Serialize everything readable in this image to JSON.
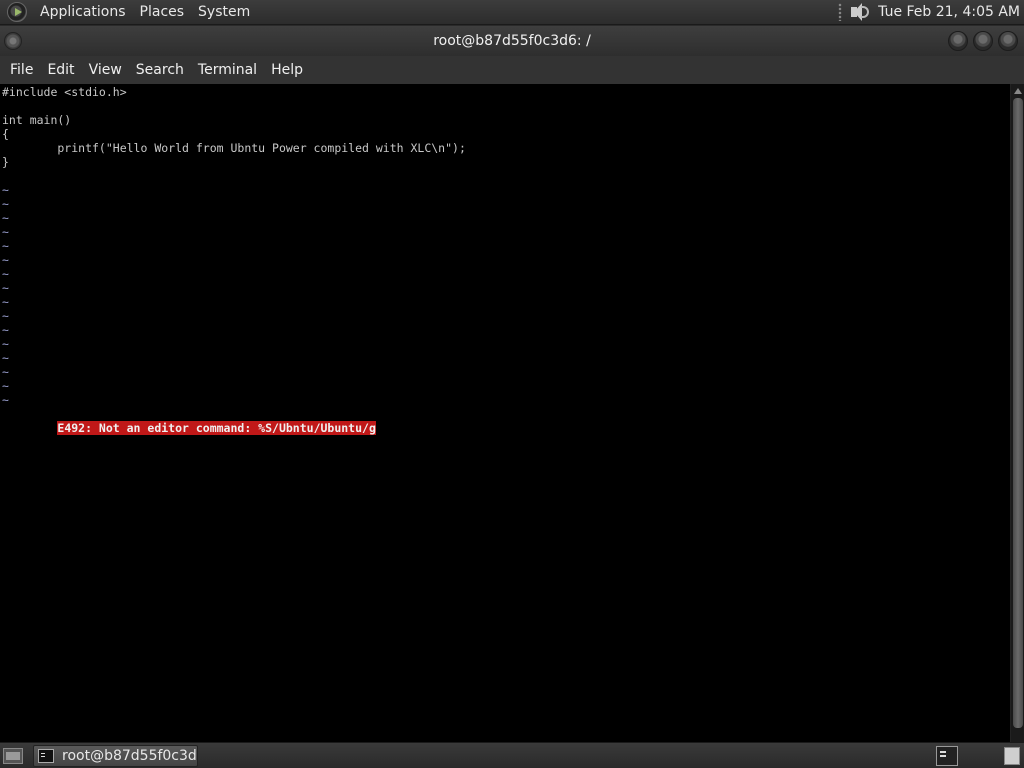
{
  "top_panel": {
    "menus": [
      "Applications",
      "Places",
      "System"
    ],
    "clock": "Tue Feb 21,  4:05 AM"
  },
  "window": {
    "title": "root@b87d55f0c3d6: /",
    "menus": [
      "File",
      "Edit",
      "View",
      "Search",
      "Terminal",
      "Help"
    ]
  },
  "terminal": {
    "code_lines": [
      "#include <stdio.h>",
      "",
      "int main()",
      "{",
      "        printf(\"Hello World from Ubntu Power compiled with XLC\\n\");",
      "}",
      ""
    ],
    "tilde_lines": [
      "~",
      "~",
      "~",
      "~",
      "~",
      "~",
      "~",
      "~",
      "~",
      "~",
      "~",
      "~",
      "~",
      "~",
      "~",
      "~"
    ],
    "error_message": "E492: Not an editor command: %S/Ubntu/Ubuntu/g"
  },
  "bottom_panel": {
    "task_label": "root@b87d55f0c3d..."
  },
  "colors": {
    "error_bg": "#c01818",
    "terminal_bg": "#000000",
    "tilde": "#9aa0d0"
  }
}
